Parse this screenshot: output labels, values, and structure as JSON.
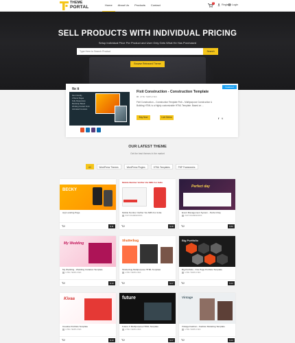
{
  "brand": {
    "line1": "THEME",
    "line2": "PORTAL",
    "accent": "#f5c518"
  },
  "nav": {
    "items": [
      {
        "label": "Home",
        "active": true
      },
      {
        "label": "About Us",
        "active": false
      },
      {
        "label": "Products",
        "active": false
      },
      {
        "label": "Contact",
        "active": false
      }
    ],
    "cart_count": "0",
    "register": "Register",
    "login": "Login"
  },
  "hero": {
    "title": "SELL PRODUCTS WITH INDIVIDUAL PRICING",
    "subtitle": "Setup Individual Price Per Product and User Only Gets What He Has Purchased",
    "search_placeholder": "Type Here to Search Product",
    "search_button": "Search",
    "browse_button": "Browse Released Theme"
  },
  "featured": {
    "ribbon": "Featured",
    "title": "Fixit Construction - Construction Template",
    "category": "HTML TEMPLATES",
    "description": "Fixit Construction – Construction Template Fixit – Multipurpose Construction & Building HTML is a Highly customizable HTML Template. Based on ...",
    "buy_label": "Buy Now",
    "demo_label": "Live Demo",
    "shot_logo": "fix it",
    "shot_list": [
      "Dev Friendly",
      "2 Demo Pages",
      "Fully Responsive",
      "Bootstrap Based",
      "Working Contact Form",
      "Animated Counters"
    ]
  },
  "latest": {
    "title": "OUR LATEST THEME",
    "subtitle": "Get the best themes in the market",
    "tabs": [
      {
        "label": "All",
        "active": true
      },
      {
        "label": "WordPress Themes",
        "active": false
      },
      {
        "label": "WordPress Plugins",
        "active": false
      },
      {
        "label": "HTML Templates",
        "active": false
      },
      {
        "label": "PHP Frameworks",
        "active": false
      }
    ]
  },
  "cards": [
    {
      "title": "App Landing Page",
      "category": "",
      "price": "$ 11",
      "thumb": "app"
    },
    {
      "title": "Mobile Number Verifier Via SMS For India",
      "category": "PHP FRAMEWORKS",
      "price": "$ 18",
      "thumb": "sms"
    },
    {
      "title": "Event Management System - Perfect Day",
      "category": "PHP FRAMEWORKS",
      "price": "$ 50",
      "thumb": "event"
    },
    {
      "title": "My Wedding - Wedding Invitation Template",
      "category": "HTML TEMPLATES",
      "price": "$ 13",
      "thumb": "wedding"
    },
    {
      "title": "Shutterbug Multipurpose HTML Template",
      "category": "HTML TEMPLATES",
      "price": "$ 17",
      "thumb": "shutter"
    },
    {
      "title": "Big Portfolio - One Page Portfolio Template",
      "category": "HTML TEMPLATES",
      "price": "$ 14",
      "thumb": "bigport"
    },
    {
      "title": "Creative Portfolio Template",
      "category": "HTML TEMPLATES",
      "price": "$ 13",
      "thumb": "creative"
    },
    {
      "title": "Future X Multipurpose HTML Template",
      "category": "HTML TEMPLATES",
      "price": "$ 17",
      "thumb": "future"
    },
    {
      "title": "Vintage Fashion - Fashion Modeling Template",
      "category": "HTML TEMPLATES",
      "price": "$ 14",
      "thumb": "vintage"
    }
  ],
  "thumb_text": {
    "app": "BECKY",
    "sms": "Mobile Number Verifier Via SMS For India",
    "event": "Perfect day",
    "wedding": "My Wedding",
    "shutter": "Shutterbug",
    "bigport": "Big Portfolio",
    "creative": "Kivaa",
    "future": "future",
    "vintage": "Vintage"
  }
}
